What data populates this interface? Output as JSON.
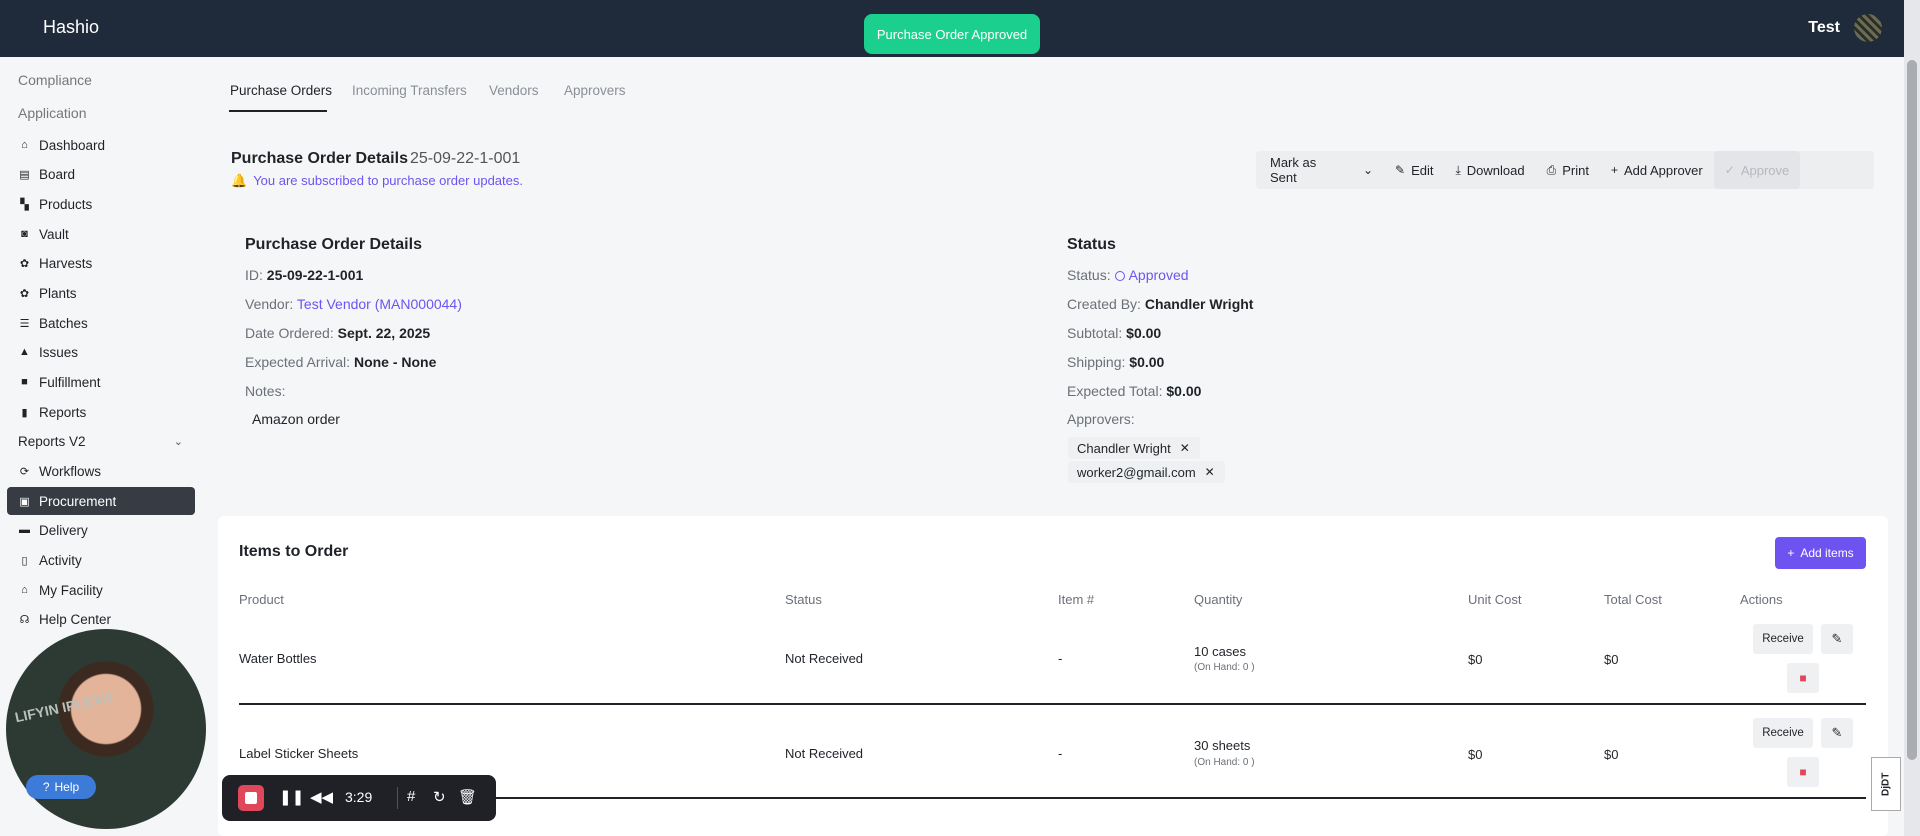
{
  "app": {
    "brand": "Hashio",
    "user_name": "Test",
    "toast": "Purchase Order Approved"
  },
  "sidebar": {
    "sections": [
      "Compliance",
      "Application"
    ],
    "items": [
      {
        "label": "Dashboard",
        "icon": "home-icon"
      },
      {
        "label": "Board",
        "icon": "board-icon"
      },
      {
        "label": "Products",
        "icon": "products-icon"
      },
      {
        "label": "Vault",
        "icon": "vault-icon"
      },
      {
        "label": "Harvests",
        "icon": "plant-icon"
      },
      {
        "label": "Plants",
        "icon": "plant-icon"
      },
      {
        "label": "Batches",
        "icon": "batches-icon"
      },
      {
        "label": "Issues",
        "icon": "warning-icon"
      },
      {
        "label": "Fulfillment",
        "icon": "box-icon"
      },
      {
        "label": "Reports",
        "icon": "bar-chart-icon"
      },
      {
        "label": "Reports V2",
        "icon": ""
      },
      {
        "label": "Workflows",
        "icon": "workflow-icon"
      },
      {
        "label": "Procurement",
        "icon": "cart-icon"
      },
      {
        "label": "Delivery",
        "icon": "truck-icon"
      },
      {
        "label": "Activity",
        "icon": "clipboard-icon"
      },
      {
        "label": "My Facility",
        "icon": "warehouse-icon"
      },
      {
        "label": "Help Center",
        "icon": "headset-icon"
      }
    ],
    "active": "Procurement"
  },
  "tabs": [
    "Purchase Orders",
    "Incoming Transfers",
    "Vendors",
    "Approvers"
  ],
  "header": {
    "title": "Purchase Order Details",
    "po_number": "25-09-22-1-001",
    "subscribed": "You are subscribed to purchase order updates."
  },
  "toolbar": {
    "mark_as_sent": "Mark as Sent",
    "edit": "Edit",
    "download": "Download",
    "print": "Print",
    "add_approver": "Add Approver",
    "approve": "Approve"
  },
  "details": {
    "title": "Purchase Order Details",
    "id_label": "ID:",
    "id_value": "25-09-22-1-001",
    "vendor_label": "Vendor:",
    "vendor_value": "Test Vendor (MAN000044)",
    "date_label": "Date Ordered:",
    "date_value": "Sept. 22, 2025",
    "arrival_label": "Expected Arrival:",
    "arrival_value": "None - None",
    "notes_label": "Notes:",
    "notes_value": "Amazon order"
  },
  "status": {
    "title": "Status",
    "status_label": "Status:",
    "status_value": "Approved",
    "created_label": "Created By:",
    "created_value": "Chandler Wright",
    "subtotal_label": "Subtotal:",
    "subtotal_value": "$0.00",
    "shipping_label": "Shipping:",
    "shipping_value": "$0.00",
    "total_label": "Expected Total:",
    "total_value": "$0.00",
    "approvers_label": "Approvers:",
    "approvers": [
      "Chandler Wright",
      "worker2@gmail.com"
    ]
  },
  "items": {
    "title": "Items to Order",
    "add_label": "Add items",
    "columns": [
      "Product",
      "Status",
      "Item #",
      "Quantity",
      "Unit Cost",
      "Total Cost",
      "Actions"
    ],
    "receive_label": "Receive",
    "rows": [
      {
        "product": "Water Bottles",
        "status": "Not Received",
        "item_no": "-",
        "quantity": "10 cases",
        "on_hand": "(On Hand: 0 )",
        "unit_cost": "$0",
        "total_cost": "$0"
      },
      {
        "product": "Label Sticker Sheets",
        "status": "Not Received",
        "item_no": "-",
        "quantity": "30 sheets",
        "on_hand": "(On Hand: 0 )",
        "unit_cost": "$0",
        "total_cost": "$0"
      }
    ]
  },
  "recorder": {
    "time": "3:29",
    "help": "Help",
    "webcam_text": "LIFYIN\nIPLEXIT"
  },
  "badge": "DjDT"
}
